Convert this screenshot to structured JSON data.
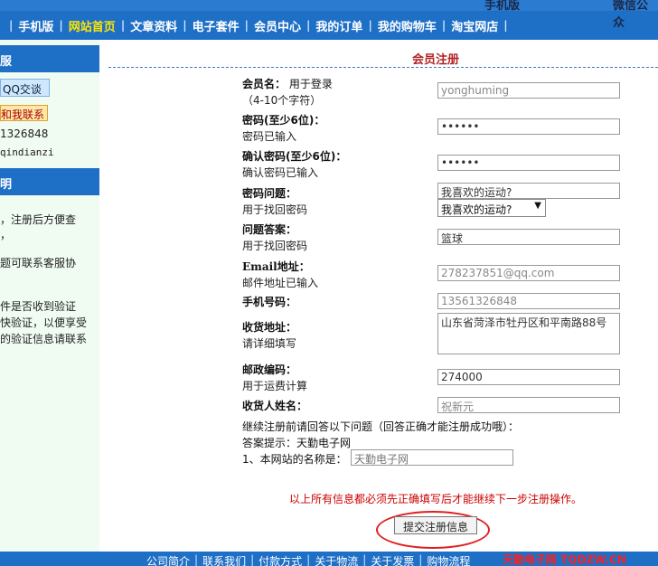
{
  "top_strip": {
    "left": "手机版",
    "right": "微信公众"
  },
  "nav": {
    "items": [
      {
        "label": "手机版",
        "active": false
      },
      {
        "label": "网站首页",
        "active": true
      },
      {
        "label": "文章资料",
        "active": false
      },
      {
        "label": "电子套件",
        "active": false
      },
      {
        "label": "会员中心",
        "active": false
      },
      {
        "label": "我的订单",
        "active": false
      },
      {
        "label": "我的购物车",
        "active": false
      },
      {
        "label": "淘宝网店",
        "active": false
      }
    ]
  },
  "sidebar": {
    "section1_title": "服",
    "qq_button": "QQ交谈",
    "contact_button": "和我联系",
    "phone": "1326848",
    "wechat": "qindianzi",
    "section2_title": "明",
    "notes": [
      "，注册后方便查",
      "，",
      "题可联系客服协",
      "件是否收到验证",
      "快验证，以便享受",
      "的验证信息请联系"
    ]
  },
  "form": {
    "title": "会员注册",
    "rows": [
      {
        "label": "会员名：",
        "label_extra": "用于登录",
        "hint": "（4-10个字符）",
        "value": "yonghuming"
      },
      {
        "label": "密码(至少6位)：",
        "hint": "密码已输入",
        "value": "••••••"
      },
      {
        "label": "确认密码(至少6位)：",
        "hint": "确认密码已输入",
        "value": "••••••"
      },
      {
        "label": "密码问题：",
        "hint": "用于找回密码",
        "value": "我喜欢的运动?",
        "select_value": "我喜欢的运动?"
      },
      {
        "label": "问题答案：",
        "hint": "用于找回密码",
        "value": "篮球"
      },
      {
        "label": "Email地址：",
        "hint": "邮件地址已输入",
        "value": "278237851@qq.com"
      },
      {
        "label": "手机号码：",
        "value": "13561326848"
      },
      {
        "label": "收货地址：",
        "hint": "请详细填写",
        "value": "山东省菏泽市牡丹区和平南路88号"
      },
      {
        "label": "邮政编码：",
        "hint": "用于运费计算",
        "value": "274000"
      },
      {
        "label": "收货人姓名：",
        "value": "祝新元"
      }
    ],
    "question_intro": "继续注册前请回答以下问题（回答正确才能注册成功哦）：",
    "answer_hint": "答案提示：天勤电子网",
    "question": "1、本网站的名称是：",
    "question_value": "天勤电子网",
    "warning": "以上所有信息都必须先正确填写后才能继续下一步注册操作。",
    "submit_label": "提交注册信息"
  },
  "footer": {
    "links": [
      "公司简介",
      "联系我们",
      "付款方式",
      "关于物流",
      "关于发票",
      "购物流程"
    ],
    "brand": "天勤电子网 TQDZW.CN"
  },
  "colors": {
    "nav_bg": "#1e6fc6",
    "nav_active": "#ffe600",
    "title_red": "#b22222",
    "warning_red": "#cc0000"
  }
}
